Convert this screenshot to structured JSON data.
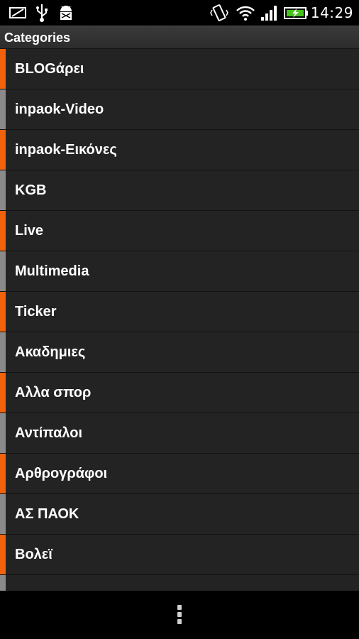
{
  "status_bar": {
    "time": "14:29",
    "icons": [
      "screenshot-icon",
      "usb-icon",
      "android-debug-icon",
      "vibrate-icon",
      "wifi-icon",
      "signal-icon",
      "battery-charging-icon"
    ],
    "battery_color": "#46c21c"
  },
  "header": {
    "title": "Categories"
  },
  "colors": {
    "accent": "#f2620a",
    "secondary": "#8a8a8a",
    "row_bg": "#232323"
  },
  "categories": [
    {
      "label": "BLOGάρει",
      "accent": "orange"
    },
    {
      "label": "inpaok-Video",
      "accent": "gray"
    },
    {
      "label": "inpaok-Εικόνες",
      "accent": "orange"
    },
    {
      "label": "KGB",
      "accent": "gray"
    },
    {
      "label": "Live",
      "accent": "orange"
    },
    {
      "label": "Multimedia",
      "accent": "gray"
    },
    {
      "label": "Ticker",
      "accent": "orange"
    },
    {
      "label": "Ακαδημιες",
      "accent": "gray"
    },
    {
      "label": "Αλλα σπορ",
      "accent": "orange"
    },
    {
      "label": "Αντίπαλοι",
      "accent": "gray"
    },
    {
      "label": "Αρθρογράφοι",
      "accent": "orange"
    },
    {
      "label": "ΑΣ ΠΑΟΚ",
      "accent": "gray"
    },
    {
      "label": "Βολεϊ",
      "accent": "orange"
    },
    {
      "label": "",
      "accent": "gray"
    }
  ],
  "bottom_bar": {
    "menu_icon": "overflow-menu-icon"
  }
}
